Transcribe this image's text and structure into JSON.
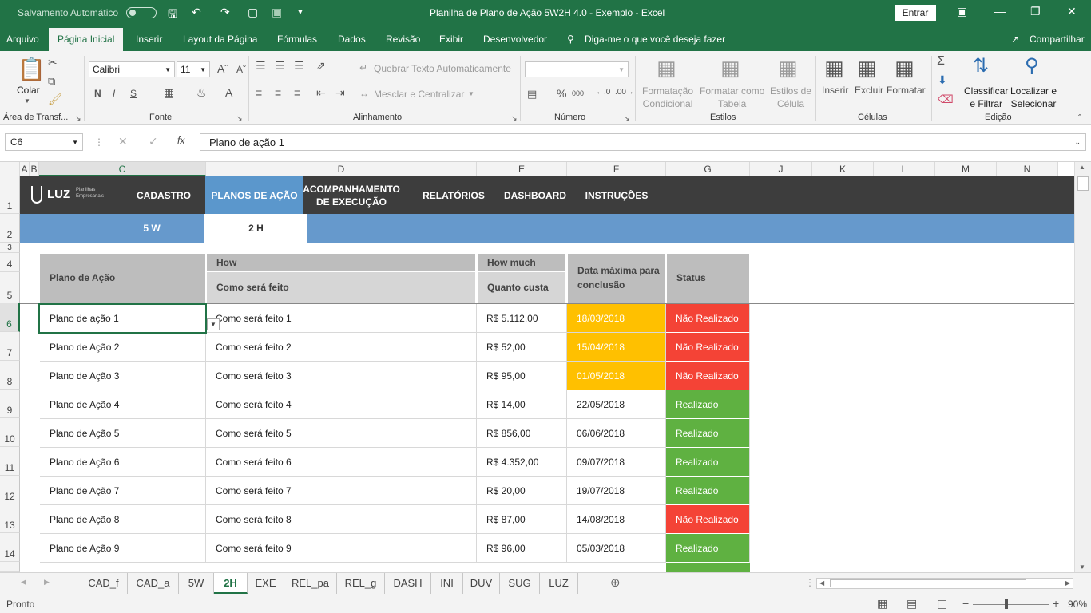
{
  "titlebar": {
    "autosave_label": "Salvamento Automático",
    "document_title": "Planilha de Plano de Ação 5W2H 4.0 - Exemplo  -  Excel",
    "signin_label": "Entrar"
  },
  "menu": {
    "tabs": [
      "Arquivo",
      "Página Inicial",
      "Inserir",
      "Layout da Página",
      "Fórmulas",
      "Dados",
      "Revisão",
      "Exibir",
      "Desenvolvedor"
    ],
    "tellme": "Diga-me o que você deseja fazer",
    "share": "Compartilhar"
  },
  "ribbon": {
    "paste_label": "Colar",
    "font_name": "Calibri",
    "font_size": "11",
    "wrap_text": "Quebrar Texto Automaticamente",
    "merge_center": "Mesclar e Centralizar",
    "cond_format": [
      "Formatação",
      "Condicional"
    ],
    "format_table": [
      "Formatar como",
      "Tabela"
    ],
    "cell_styles": [
      "Estilos de",
      "Célula"
    ],
    "insert": "Inserir",
    "delete": "Excluir",
    "format": "Formatar",
    "sort_filter": [
      "Classificar",
      "e Filtrar"
    ],
    "find_select": [
      "Localizar e",
      "Selecionar"
    ],
    "groups": [
      "Área de Transf...",
      "Fonte",
      "Alinhamento",
      "Número",
      "Estilos",
      "Células",
      "Edição"
    ]
  },
  "formula_bar": {
    "name_box": "C6",
    "formula": "Plano de ação 1",
    "fx": "fx"
  },
  "columns": [
    "A",
    "B",
    "C",
    "D",
    "E",
    "F",
    "G",
    "J",
    "K",
    "L",
    "M",
    "N"
  ],
  "rows": [
    "1",
    "2",
    "3",
    "4",
    "5",
    "6",
    "7",
    "8",
    "9",
    "10",
    "11",
    "12",
    "13",
    "14"
  ],
  "nav": {
    "logo": "LUZ",
    "logo_sub": "Planilhas Empresariais",
    "items": [
      "CADASTRO",
      "PLANOS DE AÇÃO",
      "ACOMPANHAMENTO DE EXECUÇÃO",
      "RELATÓRIOS",
      "DASHBOARD",
      "INSTRUÇÕES"
    ],
    "sub": [
      "5 W",
      "2 H"
    ]
  },
  "table": {
    "headers": {
      "plan": "Plano de Ação",
      "how": "How",
      "how_sub": "Como será feito",
      "howmuch": "How much",
      "howmuch_sub": "Quanto custa",
      "deadline": "Data máxima para conclusão",
      "status": "Status"
    },
    "rows": [
      {
        "plan": "Plano de ação 1",
        "how": "Como será feito 1",
        "cost": "R$ 5.112,00",
        "date": "18/03/2018",
        "status": "Não Realizado",
        "date_color": "#ffc000",
        "status_color": "#f44336"
      },
      {
        "plan": "Plano de Ação 2",
        "how": "Como será feito 2",
        "cost": "R$ 52,00",
        "date": "15/04/2018",
        "status": "Não Realizado",
        "date_color": "#ffc000",
        "status_color": "#f44336"
      },
      {
        "plan": "Plano de Ação 3",
        "how": "Como será feito 3",
        "cost": "R$ 95,00",
        "date": "01/05/2018",
        "status": "Não Realizado",
        "date_color": "#ffc000",
        "status_color": "#f44336"
      },
      {
        "plan": "Plano de Ação 4",
        "how": "Como será feito 4",
        "cost": "R$ 14,00",
        "date": "22/05/2018",
        "status": "Realizado",
        "date_color": "#ffffff",
        "status_color": "#5fb141"
      },
      {
        "plan": "Plano de Ação 5",
        "how": "Como será feito 5",
        "cost": "R$ 856,00",
        "date": "06/06/2018",
        "status": "Realizado",
        "date_color": "#ffffff",
        "status_color": "#5fb141"
      },
      {
        "plan": "Plano de Ação 6",
        "how": "Como será feito 6",
        "cost": "R$ 4.352,00",
        "date": "09/07/2018",
        "status": "Realizado",
        "date_color": "#ffffff",
        "status_color": "#5fb141"
      },
      {
        "plan": "Plano de Ação 7",
        "how": "Como será feito 7",
        "cost": "R$ 20,00",
        "date": "19/07/2018",
        "status": "Realizado",
        "date_color": "#ffffff",
        "status_color": "#5fb141"
      },
      {
        "plan": "Plano de Ação 8",
        "how": "Como será feito 8",
        "cost": "R$ 87,00",
        "date": "14/08/2018",
        "status": "Não Realizado",
        "date_color": "#ffffff",
        "status_color": "#f44336"
      },
      {
        "plan": "Plano de Ação 9",
        "how": "Como será feito 9",
        "cost": "R$ 96,00",
        "date": "05/03/2018",
        "status": "Realizado",
        "date_color": "#ffffff",
        "status_color": "#5fb141"
      }
    ]
  },
  "sheets": [
    "CAD_f",
    "CAD_a",
    "5W",
    "2H",
    "EXE",
    "REL_pa",
    "REL_g",
    "DASH",
    "INI",
    "DUV",
    "SUG",
    "LUZ"
  ],
  "active_sheet": "2H",
  "status": {
    "ready": "Pronto",
    "zoom": "90%"
  },
  "colors": {
    "excel_green": "#217346",
    "nav_dark": "#3d3d3d",
    "nav_blue": "#6699cc"
  }
}
